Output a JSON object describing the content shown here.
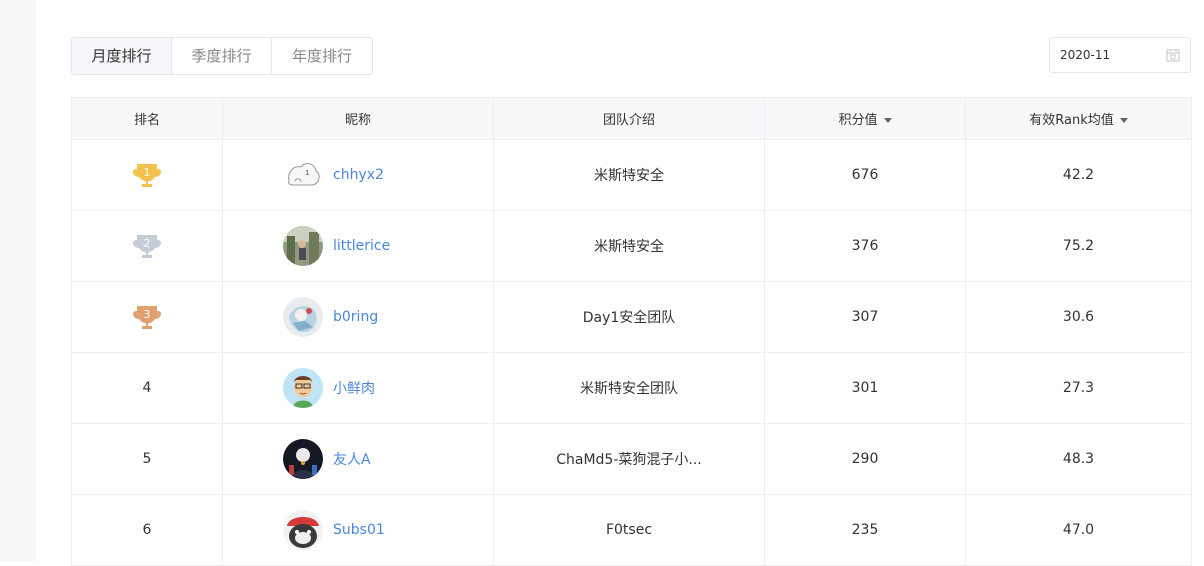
{
  "tabs": [
    {
      "label": "月度排行",
      "active": true
    },
    {
      "label": "季度排行",
      "active": false
    },
    {
      "label": "年度排行",
      "active": false
    }
  ],
  "date_picker": {
    "value": "2020-11"
  },
  "table": {
    "headers": {
      "rank": "排名",
      "nickname": "昵称",
      "team": "团队介绍",
      "score": "积分值",
      "rank_avg": "有效Rank均值"
    },
    "rows": [
      {
        "rank": "1",
        "nickname": "chhyx2",
        "team": "米斯特安全",
        "score": "676",
        "rank_avg": "42.2"
      },
      {
        "rank": "2",
        "nickname": "littlerice",
        "team": "米斯特安全",
        "score": "376",
        "rank_avg": "75.2"
      },
      {
        "rank": "3",
        "nickname": "b0ring",
        "team": "Day1安全团队",
        "score": "307",
        "rank_avg": "30.6"
      },
      {
        "rank": "4",
        "nickname": "小鲜肉",
        "team": "米斯特安全团队",
        "score": "301",
        "rank_avg": "27.3"
      },
      {
        "rank": "5",
        "nickname": "友人A",
        "team": "ChaMd5-菜狗混子小...",
        "score": "290",
        "rank_avg": "48.3"
      },
      {
        "rank": "6",
        "nickname": "Subs01",
        "team": "F0tsec",
        "score": "235",
        "rank_avg": "47.0"
      }
    ]
  },
  "colors": {
    "gold": "#f2c24c",
    "silver": "#c4ccd8",
    "bronze": "#e0a070",
    "link": "#4a86d8"
  }
}
